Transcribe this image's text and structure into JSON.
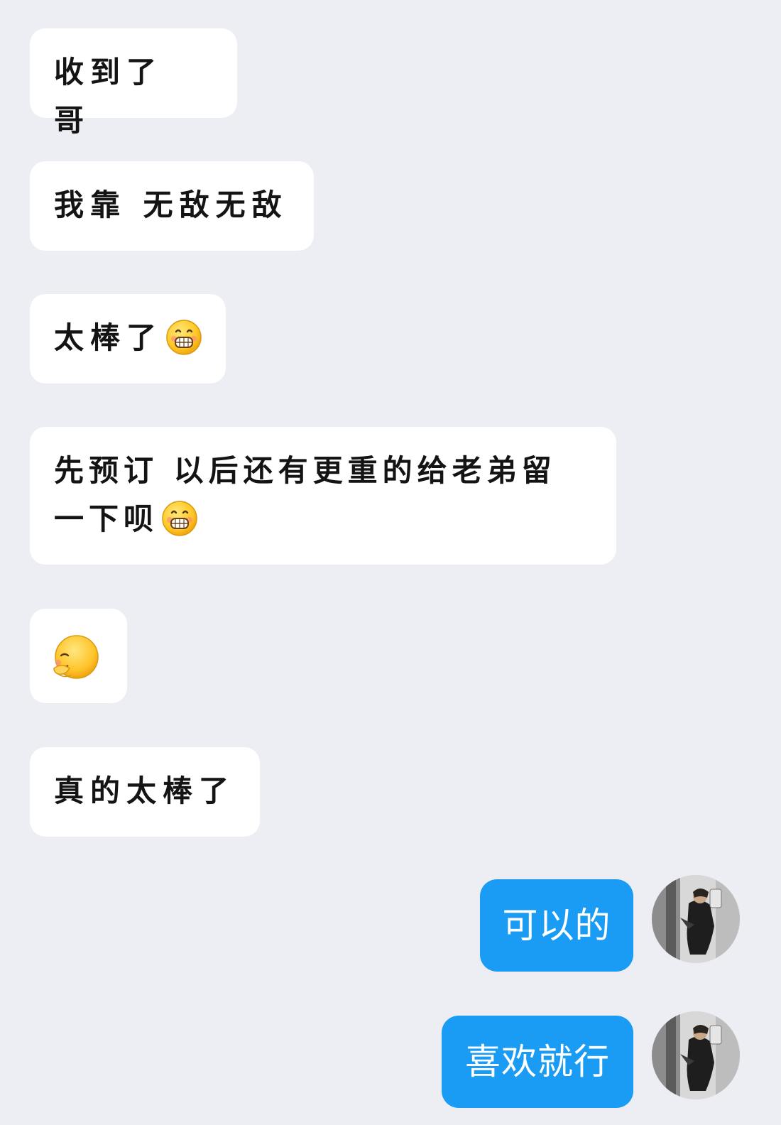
{
  "messages": [
    {
      "side": "incoming",
      "text": "收到了 哥"
    },
    {
      "side": "incoming",
      "text": "我靠 无敌无敌"
    },
    {
      "side": "incoming",
      "text": "太棒了",
      "emoji": "grin-emoji"
    },
    {
      "side": "incoming",
      "text_line1": "先预订 以后还有更重的给老弟留",
      "text_line2": "一下呗",
      "emoji": "grin-emoji"
    },
    {
      "side": "incoming",
      "emoji": "hug-emoji"
    },
    {
      "side": "incoming",
      "text": "真的太棒了"
    },
    {
      "side": "outgoing",
      "text": "可以的"
    },
    {
      "side": "outgoing",
      "text": "喜欢就行"
    }
  ],
  "colors": {
    "background": "#edeef3",
    "incoming_bubble": "#ffffff",
    "outgoing_bubble": "#1a9cf4",
    "incoming_text": "#141414",
    "outgoing_text": "#ffffff"
  },
  "icons": {
    "grin": "grin-emoji",
    "hug": "hug-emoji",
    "avatar": "user-avatar-photo"
  }
}
